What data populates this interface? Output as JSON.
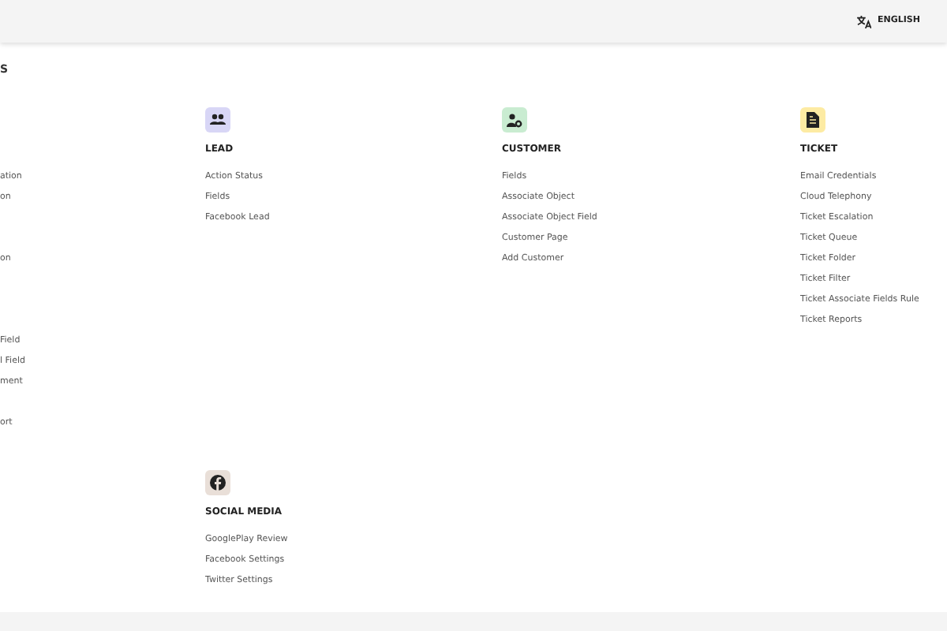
{
  "top_bar": {
    "language": "ENGLISH"
  },
  "page_title": "S",
  "cut_column": {
    "items": [
      "ation",
      "on",
      "on",
      "Field",
      "l Field",
      "ment",
      "ort"
    ]
  },
  "sections": [
    {
      "kind": "lead",
      "title": "LEAD",
      "color": "#d8d6f6",
      "items": [
        "Action Status",
        "Fields",
        "Facebook Lead"
      ]
    },
    {
      "kind": "customer",
      "title": "CUSTOMER",
      "color": "#c9ecd1",
      "items": [
        "Fields",
        "Associate Object",
        "Associate Object Field",
        "Customer Page",
        "Add Customer"
      ]
    },
    {
      "kind": "ticket",
      "title": "TICKET",
      "color": "#fdeba3",
      "items": [
        "Email Credentials",
        "Cloud Telephony",
        "Ticket Escalation",
        "Ticket Queue",
        "Ticket Folder",
        "Ticket Filter",
        "Ticket Associate Fields Rule",
        "Ticket Reports"
      ]
    },
    {
      "kind": "social",
      "title": "SOCIAL MEDIA",
      "color": "#e9dfd8",
      "items": [
        "GooglePlay Review",
        "Facebook Settings",
        "Twitter Settings"
      ]
    }
  ]
}
